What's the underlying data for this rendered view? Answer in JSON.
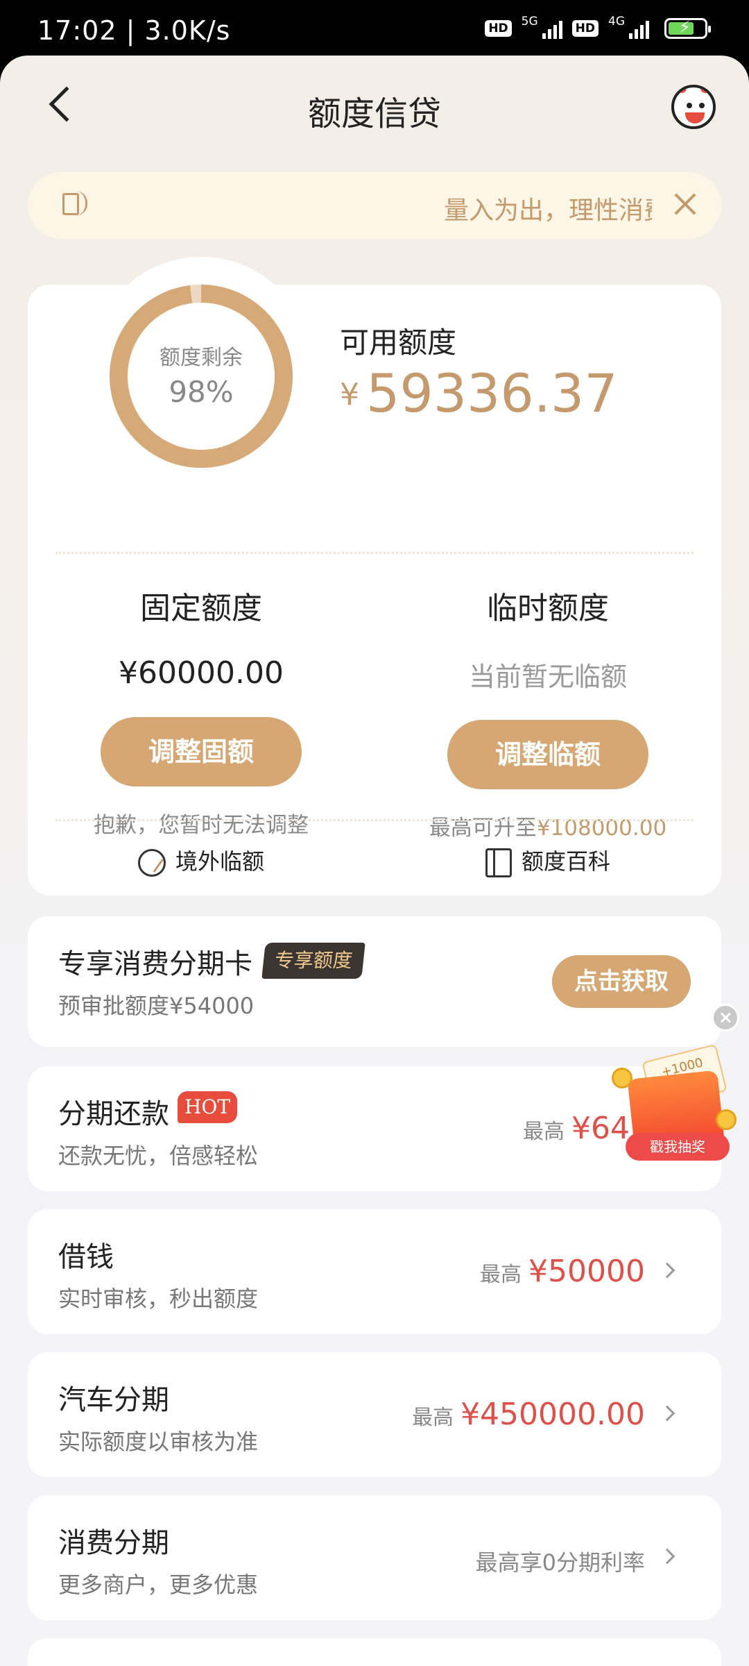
{
  "status_bar": {
    "time": "17:02",
    "speed": "3.0K/s",
    "hd1": "HD",
    "net1": "5G",
    "hd2": "HD",
    "net2": "4G",
    "battery_color": "#6fd85a"
  },
  "header": {
    "title": "额度信贷",
    "back_icon": "chevron-left-icon",
    "mascot_icon": "mascot-avatar-icon"
  },
  "notice": {
    "text": "量入为出，理性消费",
    "icon": "speaker-icon",
    "close_icon": "close-icon"
  },
  "credit": {
    "ring_label": "额度剩余",
    "ring_percent_text": "98%",
    "ring_percent_value": 0.98,
    "available_label": "可用额度",
    "currency": "¥",
    "available_amount": "59336.37",
    "fixed": {
      "title": "固定额度",
      "value": "¥60000.00",
      "button": "调整固额",
      "hint": "抱歉，您暂时无法调整"
    },
    "temporary": {
      "title": "临时额度",
      "value": "当前暂无临额",
      "button": "调整临额",
      "hint_prefix": "最高可升至",
      "hint_amount": "¥108000.00"
    },
    "links": [
      {
        "label": "境外临额",
        "icon": "plane-globe-icon"
      },
      {
        "label": "额度百科",
        "icon": "book-icon"
      }
    ]
  },
  "promo_card": {
    "title": "专享消费分期卡",
    "tag": "专享额度",
    "subtitle": "预审批额度¥54000",
    "button": "点击获取"
  },
  "products": [
    {
      "title": "分期还款",
      "tag": "HOT",
      "subtitle": "还款无忧，倍感轻松",
      "prefix": "最高",
      "amount": "¥643.6"
    },
    {
      "title": "借钱",
      "subtitle": "实时审核，秒出额度",
      "prefix": "最高",
      "amount": "¥50000"
    },
    {
      "title": "汽车分期",
      "subtitle": "实际额度以审核为准",
      "prefix": "最高",
      "amount": "¥450000.00"
    },
    {
      "title": "消费分期",
      "subtitle": "更多商户，更多优惠",
      "plain": "最高享0分期利率"
    }
  ],
  "floating_widget": {
    "label": "戳我抽奖",
    "card_text": "+1000",
    "close_icon": "close-circle-icon",
    "gift_icon": "gift-box-icon"
  },
  "colors": {
    "gold": "#c49a6c",
    "button_gold": "#d6a772",
    "red": "#e0504a"
  }
}
